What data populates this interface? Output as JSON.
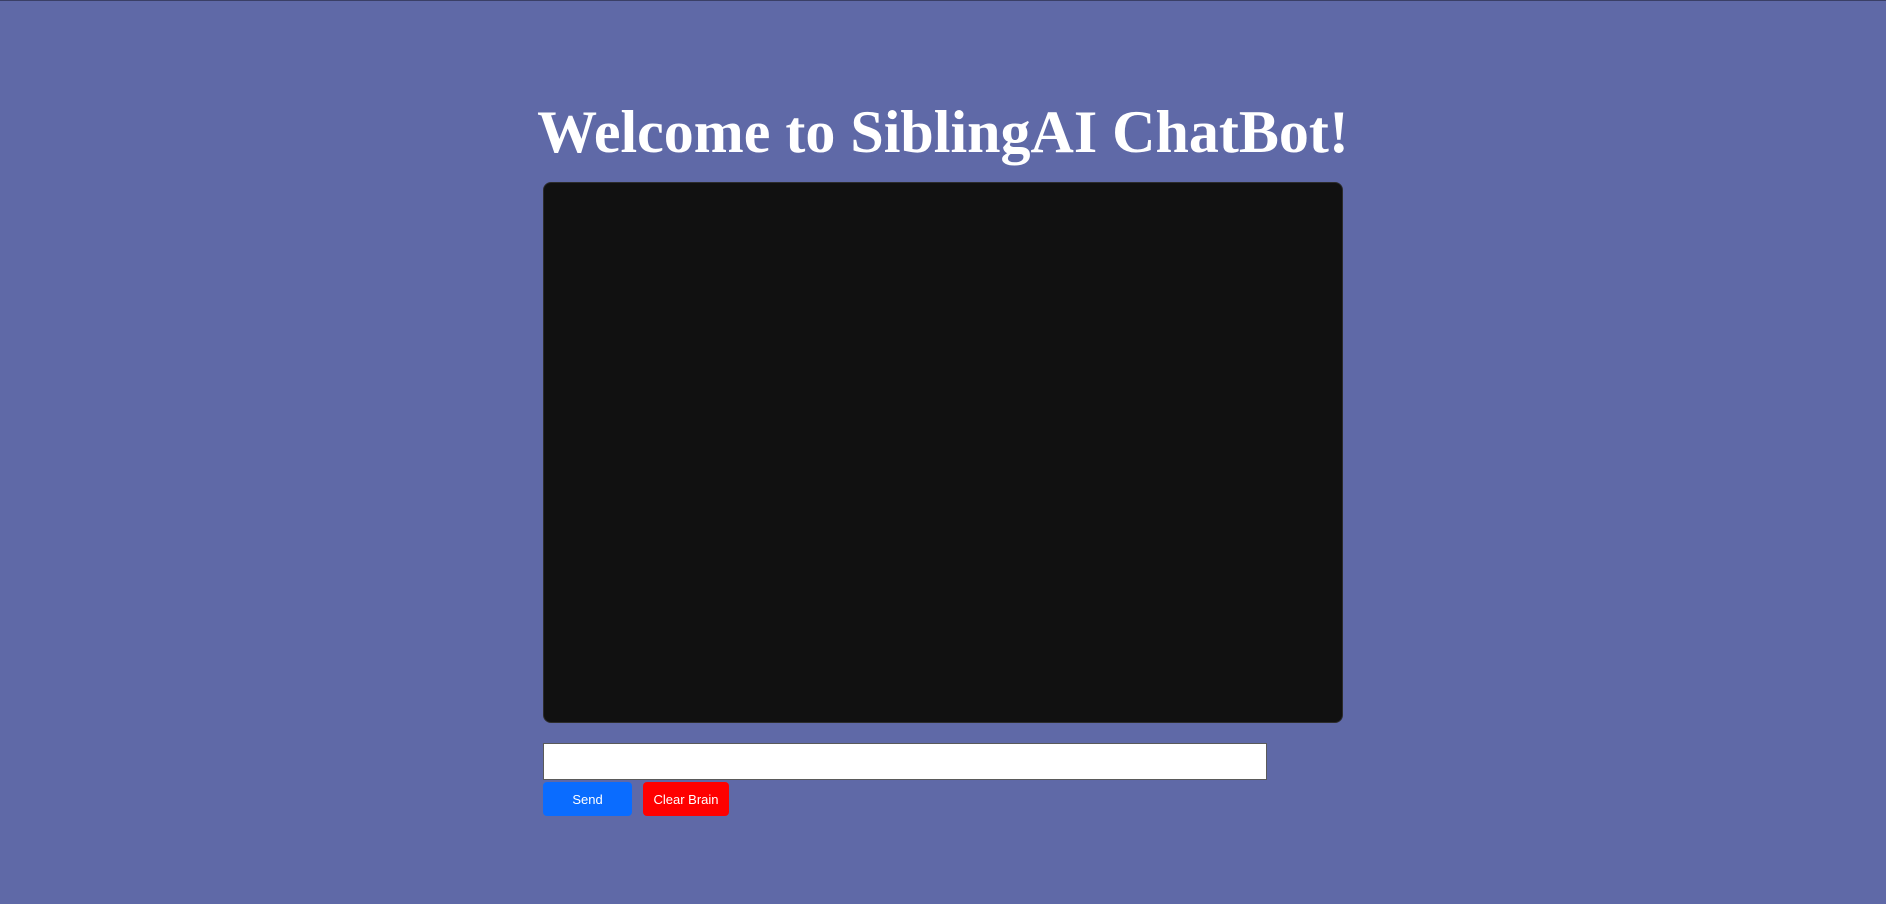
{
  "header": {
    "title": "Welcome to SiblingAI ChatBot!"
  },
  "chat": {
    "messages": []
  },
  "composer": {
    "input_value": "",
    "input_placeholder": "",
    "send_label": "Send",
    "clear_label": "Clear Brain"
  },
  "colors": {
    "background": "#5f69a7",
    "chat_background": "#111111",
    "send_button": "#0a6cff",
    "clear_button": "#ff0000"
  }
}
